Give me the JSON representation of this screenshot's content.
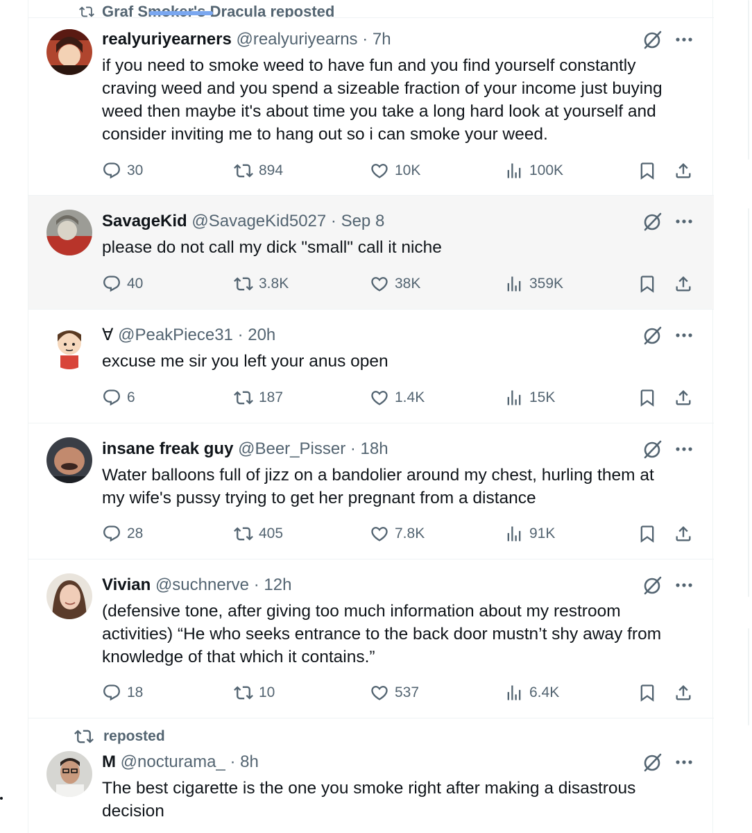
{
  "top": {
    "reposted_text": "Graf Smoker's Dracula reposted"
  },
  "tweets": [
    {
      "name": "realyuriyearners",
      "handle": "@realyuriyearns",
      "sep": "·",
      "time": "7h",
      "lines": [
        "if you need to smoke weed to have fun and you find yourself constantly",
        "craving weed and you spend a sizeable fraction of your income just buying",
        "weed then maybe it's about time you take a long hard look at yourself and",
        "consider inviting me to hang out so i can smoke your weed."
      ],
      "replies": "30",
      "reposts": "894",
      "likes": "10K",
      "views": "100K"
    },
    {
      "name": "SavageKid",
      "handle": "@SavageKid5027",
      "sep": "·",
      "time": "Sep 8",
      "lines": [
        "please do not call my dick \"small\" call it niche"
      ],
      "replies": "40",
      "reposts": "3.8K",
      "likes": "38K",
      "views": "359K"
    },
    {
      "name": "∀",
      "handle": "@PeakPiece31",
      "sep": "·",
      "time": "20h",
      "lines": [
        "excuse me sir you left your anus open"
      ],
      "replies": "6",
      "reposts": "187",
      "likes": "1.4K",
      "views": "15K"
    },
    {
      "name": "insane freak guy",
      "handle": "@Beer_Pisser",
      "sep": "·",
      "time": "18h",
      "lines": [
        "Water balloons full of jizz on a bandolier around my chest, hurling them at",
        "my wife's pussy trying to get her pregnant from a distance"
      ],
      "replies": "28",
      "reposts": "405",
      "likes": "7.8K",
      "views": "91K"
    },
    {
      "name": "Vivian",
      "handle": "@suchnerve",
      "sep": "·",
      "time": "12h",
      "lines": [
        "(defensive tone, after giving too much information about my restroom",
        "activities) “He who seeks entrance to the back door mustn’t shy away from",
        "knowledge of that which it contains.”"
      ],
      "replies": "18",
      "reposts": "10",
      "likes": "537",
      "views": "6.4K"
    },
    {
      "repost_label": "reposted",
      "name": "M",
      "handle": "@nocturama_",
      "sep": "·",
      "time": "8h",
      "lines": [
        "The best cigarette is the one you smoke right after making a disastrous",
        "decision"
      ]
    }
  ],
  "icons": {
    "reply": "reply-icon",
    "repost": "repost-icon",
    "like": "heart-icon",
    "views": "analytics-icon",
    "bookmark": "bookmark-icon",
    "share": "share-icon",
    "grok": "grok-icon",
    "more": "more-icon"
  },
  "colors": {
    "text": "#0f1419",
    "muted": "#536471",
    "border": "#eff3f4",
    "highlight": "#f6f6f6"
  }
}
